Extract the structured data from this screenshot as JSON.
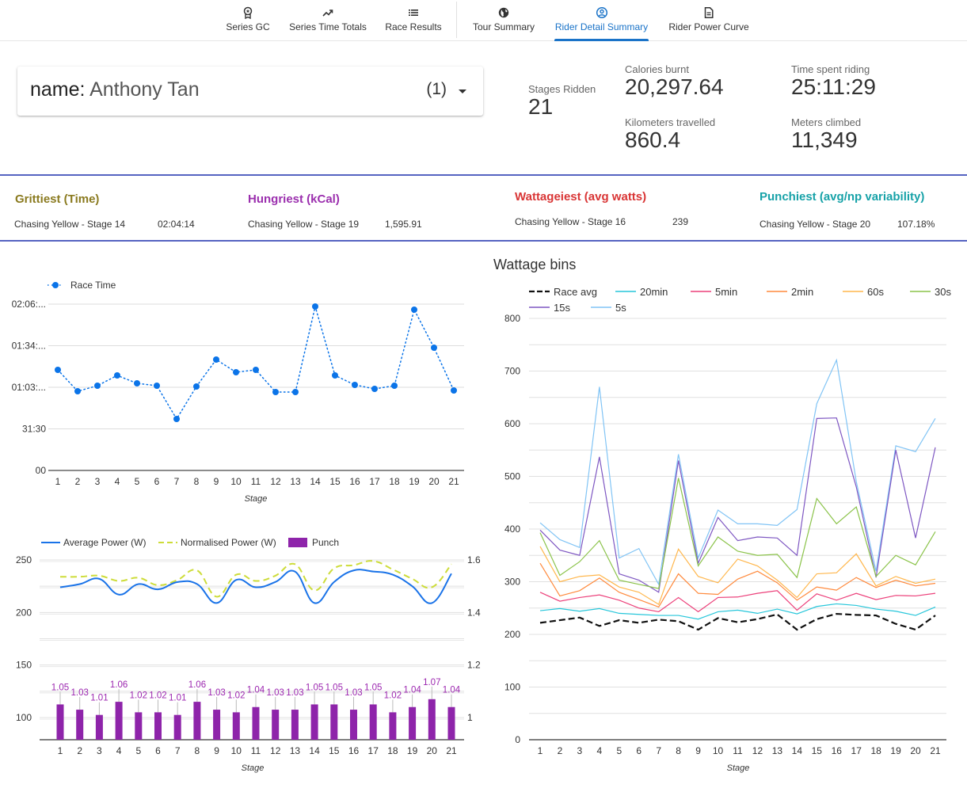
{
  "nav": {
    "items": [
      {
        "label": "Series GC",
        "icon": "award-icon"
      },
      {
        "label": "Series Time Totals",
        "icon": "trending-up-icon"
      },
      {
        "label": "Race Results",
        "icon": "list-icon"
      },
      {
        "label": "Tour Summary",
        "icon": "globe-icon"
      },
      {
        "label": "Rider Detail Summary",
        "icon": "user-circle-icon",
        "active": true
      },
      {
        "label": "Rider Power Curve",
        "icon": "document-icon"
      }
    ]
  },
  "selector": {
    "field": "name",
    "separator": ": ",
    "value": "Anthony Tan",
    "count": "(1)"
  },
  "stats": {
    "stages_ridden": {
      "label": "Stages Ridden",
      "value": "21"
    },
    "calories": {
      "label": "Calories burnt",
      "value": "20,297.64"
    },
    "time_riding": {
      "label": "Time spent riding",
      "value": "25:11:29"
    },
    "kilometers": {
      "label": "Kilometers travelled",
      "value": "860.4"
    },
    "meters_climbed": {
      "label": "Meters climbed",
      "value": "11,349"
    }
  },
  "superlatives": [
    {
      "title": "Grittiest (Time)",
      "color": "#8a7a1f",
      "stage": "Chasing Yellow - Stage 14",
      "value": "02:04:14"
    },
    {
      "title": "Hungriest (kCal)",
      "color": "#9b2fae",
      "stage": "Chasing Yellow - Stage 19",
      "value": "1,595.91"
    },
    {
      "title": "Wattageiest (avg watts)",
      "color": "#d93535",
      "stage": "Chasing Yellow - Stage 16",
      "value": "239"
    },
    {
      "title": "Punchiest (avg/np variability)",
      "color": "#17a2a8",
      "stage": "Chasing Yellow - Stage 20",
      "value": "107.18%"
    }
  ],
  "chart_data": [
    {
      "id": "race-time",
      "type": "line",
      "title": "",
      "xlabel": "Stage",
      "ylabel": "",
      "categories": [
        "1",
        "2",
        "3",
        "4",
        "5",
        "6",
        "7",
        "8",
        "9",
        "10",
        "11",
        "12",
        "13",
        "14",
        "15",
        "16",
        "17",
        "18",
        "19",
        "20",
        "21"
      ],
      "y_ticks": [
        "00",
        "31:30",
        "01:03:...",
        "01:34:...",
        "02:06:..."
      ],
      "y_tick_minutes": [
        0,
        31.5,
        63,
        94.5,
        126
      ],
      "ylim_minutes": [
        0,
        126
      ],
      "legend": "top-left",
      "series": [
        {
          "name": "Race Time",
          "color": "#0b74e8",
          "style": "dotted",
          "values": [
            "1:16:12",
            "1:00:00",
            "1:04:12",
            "1:12:00",
            "1:06:00",
            "1:04:12",
            "0:39:00",
            "1:03:36",
            "1:24:00",
            "1:14:24",
            "1:16:12",
            "0:59:24",
            "0:59:24",
            "2:04:14",
            "1:12:00",
            "1:04:48",
            "1:01:48",
            "1:04:12",
            "2:01:48",
            "1:33:00",
            "1:00:36"
          ],
          "values_minutes": [
            76.2,
            60,
            64.2,
            72,
            66,
            64.2,
            39,
            63.6,
            84,
            74.4,
            76.2,
            59.4,
            59.4,
            124.2,
            72,
            64.8,
            61.8,
            64.2,
            121.8,
            93,
            60.6
          ]
        }
      ],
      "grid": true
    },
    {
      "id": "power",
      "type": "bar+line",
      "title": "",
      "xlabel": "Stage",
      "categories": [
        "1",
        "2",
        "3",
        "4",
        "5",
        "6",
        "7",
        "8",
        "9",
        "10",
        "11",
        "12",
        "13",
        "14",
        "15",
        "16",
        "17",
        "18",
        "19",
        "20",
        "21"
      ],
      "left_axis": {
        "ticks": [
          100,
          150,
          200,
          250
        ],
        "ylim": [
          79,
          250
        ]
      },
      "right_axis": {
        "ticks": [
          "1",
          "1.2",
          "1.4",
          "1.6"
        ],
        "ylim": [
          0.915,
          1.6
        ]
      },
      "legend": "top-left",
      "grid": true,
      "series": [
        {
          "name": "Average Power (W)",
          "type": "line",
          "axis": "left",
          "color": "#1a73e8",
          "values": [
            224,
            227,
            232,
            217,
            227,
            222,
            229,
            227,
            209,
            231,
            224,
            229,
            239,
            209,
            229,
            240,
            239,
            236,
            225,
            209,
            237
          ]
        },
        {
          "name": "Normalised Power (W)",
          "type": "line",
          "axis": "left",
          "color": "#cddc39",
          "style": "dashed",
          "values": [
            234,
            234,
            235,
            230,
            233,
            226,
            231,
            240,
            215,
            236,
            230,
            235,
            246,
            221,
            242,
            245,
            249,
            241,
            232,
            224,
            246
          ]
        },
        {
          "name": "Punch",
          "type": "bar",
          "axis": "right",
          "color": "#8e24aa",
          "values": [
            1.05,
            1.03,
            1.01,
            1.06,
            1.02,
            1.02,
            1.01,
            1.06,
            1.03,
            1.02,
            1.04,
            1.03,
            1.03,
            1.05,
            1.05,
            1.03,
            1.05,
            1.02,
            1.04,
            1.07,
            1.04
          ],
          "labels": [
            "1.05",
            "1.03",
            "1.01",
            "1.06",
            "1.02",
            "1.02",
            "1.01",
            "1.06",
            "1.03",
            "1.02",
            "1.04",
            "1.03",
            "1.03",
            "1.05",
            "1.05",
            "1.03",
            "1.05",
            "1.02",
            "1.04",
            "1.07",
            "1.04"
          ]
        }
      ]
    },
    {
      "id": "wattage-bins",
      "type": "line",
      "title": "Wattage bins",
      "xlabel": "Stage",
      "ylabel": "",
      "categories": [
        "1",
        "2",
        "3",
        "4",
        "5",
        "6",
        "7",
        "8",
        "9",
        "10",
        "11",
        "12",
        "13",
        "14",
        "15",
        "16",
        "17",
        "18",
        "19",
        "20",
        "21"
      ],
      "y_ticks": [
        0,
        100,
        200,
        300,
        400,
        500,
        600,
        700,
        800
      ],
      "ylim": [
        0,
        800
      ],
      "legend": "top",
      "grid": true,
      "series": [
        {
          "name": "Race avg",
          "color": "#111111",
          "style": "dashed",
          "values": [
            222,
            227,
            232,
            216,
            227,
            222,
            228,
            225,
            209,
            231,
            223,
            229,
            238,
            209,
            229,
            239,
            237,
            236,
            220,
            209,
            236
          ]
        },
        {
          "name": "20min",
          "color": "#26c6da",
          "values": [
            245,
            249,
            244,
            249,
            240,
            238,
            236,
            236,
            229,
            243,
            246,
            240,
            248,
            239,
            253,
            258,
            255,
            248,
            244,
            236,
            252
          ]
        },
        {
          "name": "5min",
          "color": "#ec407a",
          "values": [
            280,
            263,
            270,
            275,
            265,
            250,
            243,
            270,
            243,
            270,
            271,
            278,
            283,
            246,
            277,
            265,
            278,
            266,
            274,
            273,
            278
          ]
        },
        {
          "name": "2min",
          "color": "#ff8a3d",
          "values": [
            335,
            273,
            283,
            307,
            280,
            266,
            252,
            315,
            278,
            276,
            305,
            320,
            298,
            265,
            290,
            284,
            308,
            289,
            303,
            292,
            297
          ]
        },
        {
          "name": "60s",
          "color": "#ffb74d",
          "values": [
            367,
            300,
            310,
            313,
            290,
            280,
            257,
            362,
            310,
            298,
            343,
            330,
            303,
            270,
            315,
            317,
            353,
            292,
            310,
            297,
            305
          ]
        },
        {
          "name": "30s",
          "color": "#8bc34a",
          "values": [
            393,
            312,
            338,
            378,
            303,
            295,
            287,
            497,
            330,
            385,
            358,
            350,
            352,
            308,
            458,
            410,
            442,
            310,
            350,
            332,
            395
          ]
        },
        {
          "name": "15s",
          "color": "#7e57c2",
          "values": [
            398,
            360,
            350,
            537,
            315,
            303,
            280,
            530,
            335,
            422,
            378,
            385,
            383,
            350,
            610,
            611,
            480,
            308,
            550,
            383,
            555
          ]
        },
        {
          "name": "5s",
          "color": "#81c4f5",
          "values": [
            412,
            380,
            365,
            670,
            345,
            363,
            295,
            542,
            345,
            436,
            410,
            410,
            407,
            437,
            638,
            721,
            490,
            320,
            558,
            547,
            610
          ]
        }
      ]
    }
  ]
}
